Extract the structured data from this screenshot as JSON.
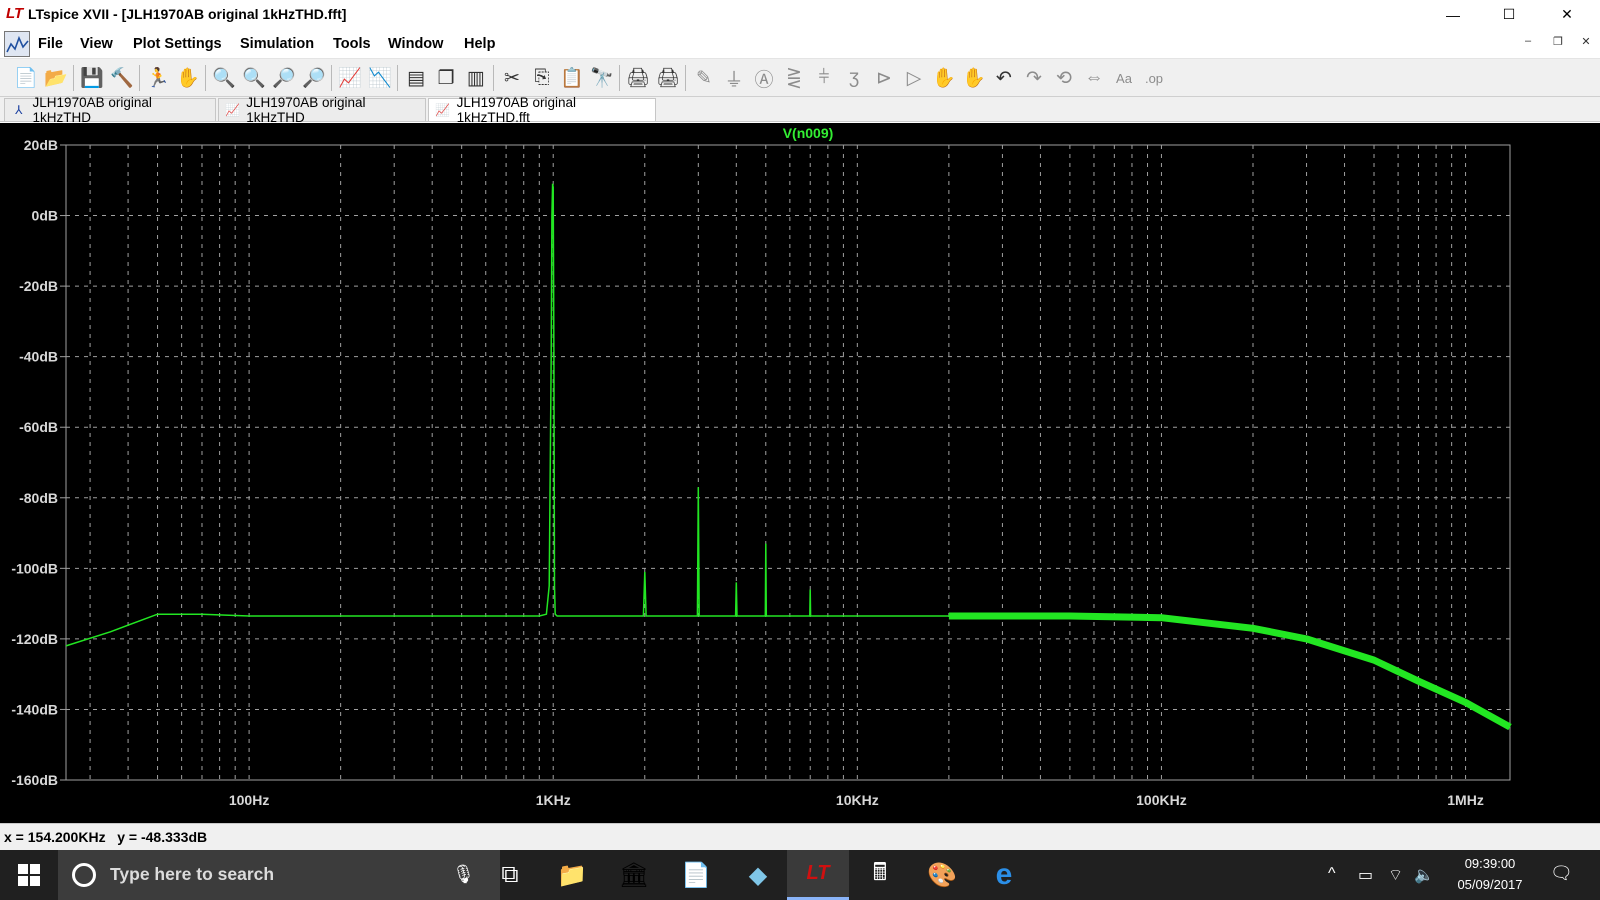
{
  "window": {
    "app_logo": "LT",
    "title": "LTspice XVII - [JLH1970AB original 1kHzTHD.fft]",
    "controls": {
      "minimize": "—",
      "maximize": "☐",
      "close": "✕"
    },
    "mdi_controls": {
      "minimize": "–",
      "restore": "❐",
      "close": "✕"
    }
  },
  "menu": {
    "items": [
      "File",
      "View",
      "Plot Settings",
      "Simulation",
      "Tools",
      "Window",
      "Help"
    ]
  },
  "toolbar": {
    "icons": [
      {
        "name": "new-schematic-icon",
        "glyph": "📄",
        "dim": false
      },
      {
        "name": "open-icon",
        "glyph": "📂",
        "dim": false
      },
      {
        "name": "save-icon",
        "glyph": "💾",
        "dim": false
      },
      {
        "name": "control-panel-icon",
        "glyph": "🔨",
        "dim": false
      },
      {
        "name": "run-icon",
        "glyph": "🏃",
        "dim": true
      },
      {
        "name": "halt-icon",
        "glyph": "✋",
        "dim": true
      },
      {
        "name": "zoom-in-icon",
        "glyph": "🔍",
        "dim": false
      },
      {
        "name": "zoom-area-icon",
        "glyph": "🔍",
        "dim": false
      },
      {
        "name": "zoom-out-icon",
        "glyph": "🔎",
        "dim": false
      },
      {
        "name": "zoom-fit-icon",
        "glyph": "🔎",
        "dim": false
      },
      {
        "name": "autorange-icon",
        "glyph": "📈",
        "dim": false
      },
      {
        "name": "manual-limits-icon",
        "glyph": "📉",
        "dim": false
      },
      {
        "name": "tile-horizontal-icon",
        "glyph": "▤",
        "dim": false
      },
      {
        "name": "cascade-icon",
        "glyph": "❐",
        "dim": false
      },
      {
        "name": "tile-vertical-icon",
        "glyph": "▥",
        "dim": false
      },
      {
        "name": "cut-icon",
        "glyph": "✂",
        "dim": false
      },
      {
        "name": "copy-icon",
        "glyph": "⎘",
        "dim": false
      },
      {
        "name": "paste-icon",
        "glyph": "📋",
        "dim": false
      },
      {
        "name": "find-icon",
        "glyph": "🔭",
        "dim": false
      },
      {
        "name": "print-icon",
        "glyph": "🖨",
        "dim": false
      },
      {
        "name": "print-preview-icon",
        "glyph": "🖨",
        "dim": false
      },
      {
        "name": "wire-icon",
        "glyph": "✎",
        "dim": true
      },
      {
        "name": "ground-icon",
        "glyph": "⏚",
        "dim": true
      },
      {
        "name": "label-net-icon",
        "glyph": "Ⓐ",
        "dim": true
      },
      {
        "name": "resistor-icon",
        "glyph": "⋛",
        "dim": true
      },
      {
        "name": "capacitor-icon",
        "glyph": "⫩",
        "dim": true
      },
      {
        "name": "inductor-icon",
        "glyph": "ʒ",
        "dim": true
      },
      {
        "name": "diode-icon",
        "glyph": "⊳",
        "dim": true
      },
      {
        "name": "component-icon",
        "glyph": "▷",
        "dim": true
      },
      {
        "name": "move-icon",
        "glyph": "✋",
        "dim": true
      },
      {
        "name": "drag-icon",
        "glyph": "✋",
        "dim": true
      },
      {
        "name": "undo-icon",
        "glyph": "↶",
        "dim": false
      },
      {
        "name": "redo-icon",
        "glyph": "↷",
        "dim": true
      },
      {
        "name": "rotate-icon",
        "glyph": "⟲",
        "dim": true
      },
      {
        "name": "mirror-icon",
        "glyph": "⇔",
        "dim": true
      },
      {
        "name": "text-icon",
        "glyph": "Aa",
        "dim": true
      },
      {
        "name": "spice-directive-icon",
        "glyph": ".op",
        "dim": true
      }
    ]
  },
  "tabs": [
    {
      "label": "JLH1970AB original 1kHzTHD",
      "icon": "schematic-tab-icon",
      "glyph": "⅄",
      "active": false
    },
    {
      "label": "JLH1970AB original 1kHzTHD",
      "icon": "waveform-tab-icon",
      "glyph": "📈",
      "active": false
    },
    {
      "label": "JLH1970AB original 1kHzTHD.fft",
      "icon": "fft-tab-icon",
      "glyph": "📈",
      "active": true
    }
  ],
  "status": {
    "text": "x = 154.200KHz   y = -48.333dB"
  },
  "taskbar": {
    "search_placeholder": "Type here to search",
    "apps": [
      {
        "name": "task-view-icon",
        "glyph": "⧉",
        "active": false
      },
      {
        "name": "file-explorer-icon",
        "glyph": "📁",
        "active": false
      },
      {
        "name": "bank-app-icon",
        "glyph": "🏛",
        "active": false
      },
      {
        "name": "document-app-icon",
        "glyph": "📄",
        "active": false
      },
      {
        "name": "shape-app-icon",
        "glyph": "◆",
        "active": false
      },
      {
        "name": "ltspice-taskbar-icon",
        "glyph": "LT",
        "active": true
      },
      {
        "name": "calculator-icon",
        "glyph": "🖩",
        "active": false
      },
      {
        "name": "paint-app-icon",
        "glyph": "🎨",
        "active": false
      },
      {
        "name": "edge-browser-icon",
        "glyph": "e",
        "active": false
      }
    ],
    "tray": [
      "^",
      "▭",
      "⌔",
      "🔈"
    ],
    "time": "09:39:00",
    "date": "05/09/2017",
    "notification_glyph": "🗨"
  },
  "colors": {
    "plot_background": "#000000",
    "trace": "#22e622",
    "trace_title": "#33ee33",
    "grid": "#a0a0a0",
    "axis_text": "#d8d8d8"
  },
  "chart_data": {
    "type": "line",
    "title": "V(n009)",
    "xlabel": "",
    "ylabel": "",
    "x_scale": "log",
    "xlim_hz": [
      25,
      1400000
    ],
    "ylim": [
      -160,
      20
    ],
    "y_ticks": [
      20,
      0,
      -20,
      -40,
      -60,
      -80,
      -100,
      -120,
      -140,
      -160
    ],
    "y_tick_labels": [
      "20dB",
      "0dB",
      "-20dB",
      "-40dB",
      "-60dB",
      "-80dB",
      "-100dB",
      "-120dB",
      "-140dB",
      "-160dB"
    ],
    "x_ticks": [
      100,
      1000,
      10000,
      100000,
      1000000
    ],
    "x_tick_labels": [
      "100Hz",
      "1KHz",
      "10KHz",
      "100KHz",
      "1MHz"
    ],
    "grid": true,
    "series": [
      {
        "name": "V(n009)",
        "x": [
          25,
          35,
          50,
          70,
          100,
          200,
          400,
          700,
          900,
          950,
          970,
          985,
          990,
          995,
          1000,
          1005,
          1010,
          1015,
          1030,
          1060,
          1500,
          1980,
          2000,
          2020,
          2500,
          2980,
          3000,
          3020,
          3500,
          3980,
          4000,
          4020,
          4500,
          4980,
          5000,
          5020,
          6000,
          6980,
          7000,
          7020,
          8000,
          9000,
          9500,
          20000,
          50000,
          100000,
          200000,
          300000,
          500000,
          700000,
          1000000,
          1400000
        ],
        "y": [
          -122,
          -118,
          -113,
          -113,
          -113.5,
          -113.5,
          -113.5,
          -113.5,
          -113.5,
          -113,
          -105,
          -40,
          0,
          9,
          8,
          -40,
          -105,
          -113,
          -113.5,
          -113.5,
          -113.5,
          -113.5,
          -101,
          -113.5,
          -113.5,
          -113.5,
          -77,
          -113.5,
          -113.5,
          -113.5,
          -104,
          -113.5,
          -113.5,
          -113.5,
          -93,
          -113.5,
          -113.5,
          -113.5,
          -106,
          -113.5,
          -113.5,
          -113.5,
          -113.5,
          -113.5,
          -113.5,
          -114,
          -117,
          -120,
          -126,
          -132,
          -138,
          -145
        ]
      }
    ]
  }
}
